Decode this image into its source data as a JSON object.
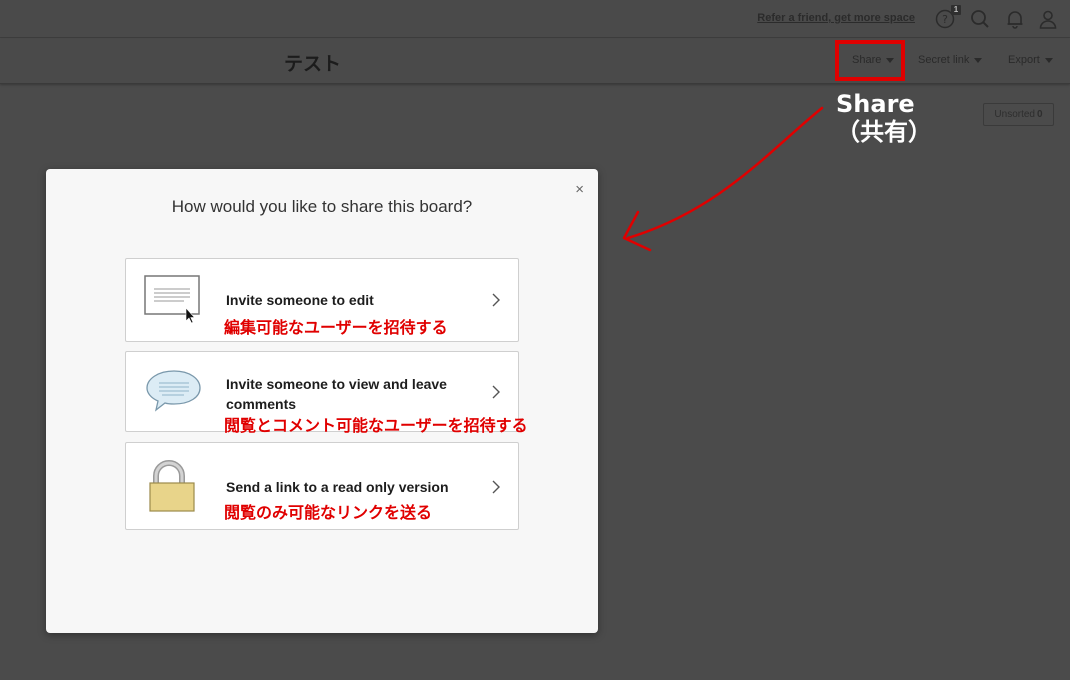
{
  "topbar": {
    "refer_link": "Refer a friend, get more space",
    "help_badge": "1"
  },
  "board": {
    "title": "テスト",
    "share_label": "Share",
    "secret_link_label": "Secret link",
    "export_label": "Export",
    "unsorted_label": "Unsorted",
    "unsorted_count": "0"
  },
  "annotation": {
    "line1": "Share",
    "line2": "（共有）",
    "color": "#e00000"
  },
  "modal": {
    "close": "×",
    "title": "How would you like to share this board?",
    "options": [
      {
        "label": "Invite someone to edit",
        "jp": "編集可能なユーザーを招待する",
        "icon": "document-cursor-icon"
      },
      {
        "label": "Invite someone to view and leave comments",
        "jp": "閲覧とコメント可能なユーザーを招待する",
        "icon": "speech-bubble-icon"
      },
      {
        "label": "Send a link to a read only version",
        "jp": "閲覧のみ可能なリンクを送る",
        "icon": "padlock-icon"
      }
    ]
  }
}
